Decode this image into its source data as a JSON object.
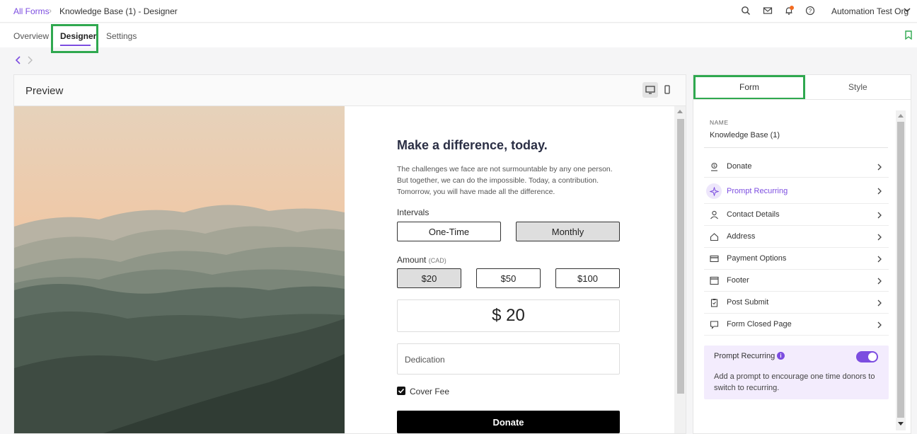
{
  "breadcrumb": {
    "root": "All Forms",
    "current": "Knowledge Base (1) - Designer"
  },
  "header": {
    "org": "Automation Test Org"
  },
  "tabs": [
    {
      "label": "Overview"
    },
    {
      "label": "Designer"
    },
    {
      "label": "Settings"
    }
  ],
  "preview": {
    "title": "Preview",
    "form": {
      "heading": "Make a difference, today.",
      "description": "The challenges we face are not surmountable by any one person. But together, we can do the impossible. Today, a contribution. Tomorrow, you will have made all the difference.",
      "intervals_label": "Intervals",
      "intervals": [
        "One-Time",
        "Monthly"
      ],
      "selected_interval": "Monthly",
      "amount_label": "Amount",
      "currency": "(CAD)",
      "amounts": [
        "$20",
        "$50",
        "$100"
      ],
      "selected_amount": "$20",
      "amount_display": "$ 20",
      "dedication_placeholder": "Dedication",
      "cover_fee_label": "Cover Fee",
      "cover_fee_checked": true,
      "donate_label": "Donate"
    }
  },
  "right_panel": {
    "tabs": [
      "Form",
      "Style"
    ],
    "active_tab": "Form",
    "name_label": "NAME",
    "name_value": "Knowledge Base (1)",
    "menu": [
      {
        "label": "Donate",
        "icon": "donate-icon"
      },
      {
        "label": "Prompt Recurring",
        "icon": "sparkle-icon",
        "active": true
      },
      {
        "label": "Contact Details",
        "icon": "person-icon"
      },
      {
        "label": "Address",
        "icon": "home-icon"
      },
      {
        "label": "Payment Options",
        "icon": "card-icon"
      },
      {
        "label": "Footer",
        "icon": "window-icon"
      },
      {
        "label": "Post Submit",
        "icon": "clipboard-icon"
      },
      {
        "label": "Form Closed Page",
        "icon": "chat-icon"
      }
    ],
    "recurring": {
      "title": "Prompt Recurring",
      "enabled": true,
      "description": "Add a prompt to encourage one time donors to switch to recurring."
    }
  },
  "colors": {
    "accent": "#7c4de0",
    "highlight": "#2fa84f"
  }
}
